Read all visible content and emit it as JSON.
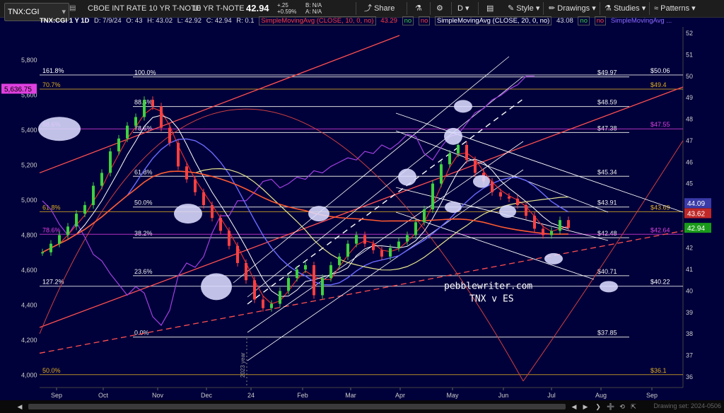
{
  "toolbar": {
    "symbol": "TNX:CGI",
    "description": "CBOE INT RATE 10 YR T-NOTE",
    "short_name": "10 YR T-NOTE",
    "last": "42.94",
    "change": "+.25",
    "change_pct": "+0.59%",
    "bid": "B: N/A",
    "ask": "A: N/A",
    "share": "Share",
    "period": "D",
    "style": "Style",
    "drawings": "Drawings",
    "studies": "Studies",
    "patterns": "Patterns"
  },
  "infobar": {
    "label": "TNX:CGI 1 Y 1D",
    "date": "D: 7/9/24",
    "open": "O: 43",
    "high": "H: 43.02",
    "low": "L: 42.92",
    "close": "C: 42.94",
    "range": "R: 0.1",
    "sma10_label": "SimpleMovingAvg (CLOSE, 10, 0, no)",
    "sma10_value": "43.29",
    "sma20_label": "SimpleMovingAvg (CLOSE, 20, 0, no)",
    "sma20_value": "43.08",
    "flag_no": "no",
    "sma_other_label": "SimpleMovingAvg ..."
  },
  "watermark": "pebblewriter.com",
  "watermark2": "TNX v ES",
  "year_marker": "2023 year",
  "bottom_right": "Drawing set: 2024-0506",
  "chart_data": {
    "type": "line",
    "title": "",
    "xlabel": "",
    "ylabel": "",
    "x_tick_labels": [
      "Sep",
      "Oct",
      "Nov",
      "Dec",
      "24",
      "Feb",
      "Mar",
      "Apr",
      "May",
      "Jun",
      "Jul",
      "Aug",
      "Sep"
    ],
    "y_right": {
      "ticks": [
        36,
        37,
        38,
        39,
        40,
        41,
        42,
        43,
        44,
        45,
        46,
        47,
        48,
        49,
        50,
        51,
        52
      ],
      "range": [
        35.5,
        52.3
      ]
    },
    "y_left": {
      "ticks": [
        "4,000",
        "4,200",
        "4,400",
        "4,600",
        "4,800",
        "5,000",
        "5,200",
        "5,400",
        "5,600",
        "5,800"
      ],
      "range": [
        3930,
        5990
      ]
    },
    "last_price_tags": [
      {
        "value": "44.09",
        "color": "#3a3aa8"
      },
      {
        "value": "43.62",
        "color": "#c02828"
      },
      {
        "value": "42.94",
        "color": "#1a9a1a"
      }
    ],
    "left_tag": {
      "value": "5,636.75",
      "color": "#e040e0"
    },
    "fib_levels_right": [
      {
        "label": "100.0%",
        "value": "$49.97",
        "y": 49.97
      },
      {
        "label": "88.6%",
        "value": "$48.59",
        "y": 48.59
      },
      {
        "label": "78.6%",
        "value": "$47.38",
        "y": 47.38
      },
      {
        "label": "61.8%",
        "value": "$45.34",
        "y": 45.34
      },
      {
        "label": "50.0%",
        "value": "$43.91",
        "y": 43.91
      },
      {
        "label": "38.2%",
        "value": "$42.48",
        "y": 42.48
      },
      {
        "label": "23.6%",
        "value": "$40.71",
        "y": 40.71
      },
      {
        "label": "0.0%",
        "value": "$37.85",
        "y": 37.85
      }
    ],
    "fib_levels_left": [
      {
        "label": "161.8%",
        "value": "$50.06",
        "y": 50.06,
        "color": "#ffffff"
      },
      {
        "label": "70.7%",
        "value": "$49.4",
        "y": 49.4,
        "color": "#e0b020"
      },
      {
        "label": "88.6%",
        "value": "$47.55",
        "y": 47.55,
        "color": "#e040e0"
      },
      {
        "label": "61.8%",
        "value": "$43.69",
        "y": 43.69,
        "color": "#e0b020"
      },
      {
        "label": "78.6%",
        "value": "$42.64",
        "y": 42.64,
        "color": "#e040e0"
      },
      {
        "label": "127.2%",
        "value": "$40.22",
        "y": 40.22,
        "color": "#ffffff"
      },
      {
        "label": "50.0%",
        "value": "$36.1",
        "y": 36.1,
        "color": "#e0b020"
      }
    ],
    "series": [
      {
        "name": "TNX",
        "kind": "candles",
        "values": [
          [
            0,
            41.8
          ],
          [
            4,
            42.2
          ],
          [
            8,
            42.6
          ],
          [
            12,
            43.0
          ],
          [
            16,
            43.6
          ],
          [
            20,
            44.0
          ],
          [
            24,
            44.9
          ],
          [
            28,
            45.5
          ],
          [
            32,
            46.5
          ],
          [
            36,
            47.1
          ],
          [
            40,
            47.7
          ],
          [
            44,
            48.1
          ],
          [
            48,
            48.9
          ],
          [
            52,
            48.6
          ],
          [
            56,
            47.6
          ],
          [
            60,
            46.9
          ],
          [
            64,
            45.8
          ],
          [
            68,
            45.2
          ],
          [
            72,
            44.6
          ],
          [
            76,
            44.0
          ],
          [
            80,
            43.4
          ],
          [
            84,
            42.8
          ],
          [
            88,
            42.1
          ],
          [
            92,
            41.3
          ],
          [
            96,
            40.5
          ],
          [
            100,
            39.6
          ],
          [
            104,
            39.2
          ],
          [
            108,
            39.4
          ],
          [
            112,
            40.0
          ],
          [
            116,
            40.6
          ],
          [
            120,
            41.0
          ],
          [
            124,
            41.2
          ],
          [
            128,
            39.8
          ],
          [
            132,
            40.6
          ],
          [
            136,
            41.2
          ],
          [
            140,
            41.6
          ],
          [
            144,
            42.2
          ],
          [
            148,
            42.6
          ],
          [
            152,
            42.2
          ],
          [
            156,
            41.9
          ],
          [
            160,
            41.6
          ],
          [
            164,
            42.0
          ],
          [
            168,
            42.3
          ],
          [
            172,
            42.6
          ],
          [
            176,
            43.2
          ],
          [
            180,
            43.8
          ],
          [
            184,
            45.0
          ],
          [
            188,
            45.9
          ],
          [
            192,
            46.4
          ],
          [
            196,
            46.8
          ],
          [
            200,
            46.1
          ],
          [
            204,
            45.5
          ],
          [
            208,
            45.1
          ],
          [
            212,
            44.6
          ],
          [
            216,
            44.4
          ],
          [
            220,
            44.3
          ],
          [
            224,
            44.0
          ],
          [
            228,
            43.5
          ],
          [
            232,
            42.9
          ],
          [
            236,
            42.6
          ],
          [
            240,
            42.8
          ],
          [
            244,
            43.3
          ],
          [
            248,
            42.94
          ]
        ]
      },
      {
        "name": "SMA 10",
        "color": "#e03030"
      },
      {
        "name": "SMA 20",
        "color": "#ffffff"
      },
      {
        "name": "SMA 50",
        "color": "#6a6aff"
      },
      {
        "name": "SMA 100",
        "color": "#e8e890"
      },
      {
        "name": "SMA 200",
        "color": "#ff5a30"
      },
      {
        "name": "ES (overlay)",
        "color": "#a040e0",
        "values": [
          [
            0,
            44.2
          ],
          [
            4,
            43.8
          ],
          [
            8,
            43.1
          ],
          [
            12,
            42.6
          ],
          [
            16,
            43.2
          ],
          [
            20,
            42.5
          ],
          [
            24,
            41.7
          ],
          [
            28,
            41.4
          ],
          [
            32,
            40.8
          ],
          [
            36,
            40.3
          ],
          [
            40,
            39.8
          ],
          [
            44,
            40.2
          ],
          [
            48,
            39.9
          ],
          [
            52,
            38.8
          ],
          [
            56,
            38.4
          ],
          [
            60,
            39.1
          ],
          [
            64,
            40.7
          ],
          [
            68,
            41.3
          ],
          [
            72,
            41.1
          ],
          [
            76,
            41.6
          ],
          [
            80,
            42.7
          ],
          [
            84,
            43.5
          ],
          [
            88,
            43.5
          ],
          [
            92,
            44.2
          ],
          [
            96,
            44.2
          ],
          [
            100,
            44.6
          ],
          [
            104,
            45.1
          ],
          [
            108,
            45.2
          ],
          [
            112,
            44.8
          ],
          [
            116,
            45.0
          ],
          [
            120,
            45.3
          ],
          [
            124,
            45.2
          ],
          [
            128,
            45.6
          ],
          [
            132,
            45.5
          ],
          [
            136,
            45.8
          ],
          [
            140,
            46.0
          ],
          [
            144,
            46.2
          ],
          [
            148,
            46.1
          ],
          [
            152,
            46.5
          ],
          [
            156,
            46.4
          ],
          [
            160,
            46.8
          ],
          [
            164,
            46.6
          ],
          [
            168,
            46.9
          ],
          [
            172,
            47.3
          ],
          [
            176,
            47.2
          ],
          [
            180,
            46.4
          ],
          [
            184,
            46.1
          ],
          [
            188,
            46.7
          ],
          [
            192,
            47.2
          ],
          [
            196,
            47.3
          ],
          [
            200,
            47.8
          ],
          [
            204,
            48.3
          ],
          [
            208,
            48.5
          ],
          [
            212,
            48.9
          ],
          [
            216,
            49.1
          ],
          [
            220,
            49.4
          ],
          [
            224,
            49.6
          ],
          [
            228,
            50.0
          ],
          [
            232,
            50.0
          ]
        ]
      }
    ],
    "grid": false,
    "legend": "top-left"
  }
}
